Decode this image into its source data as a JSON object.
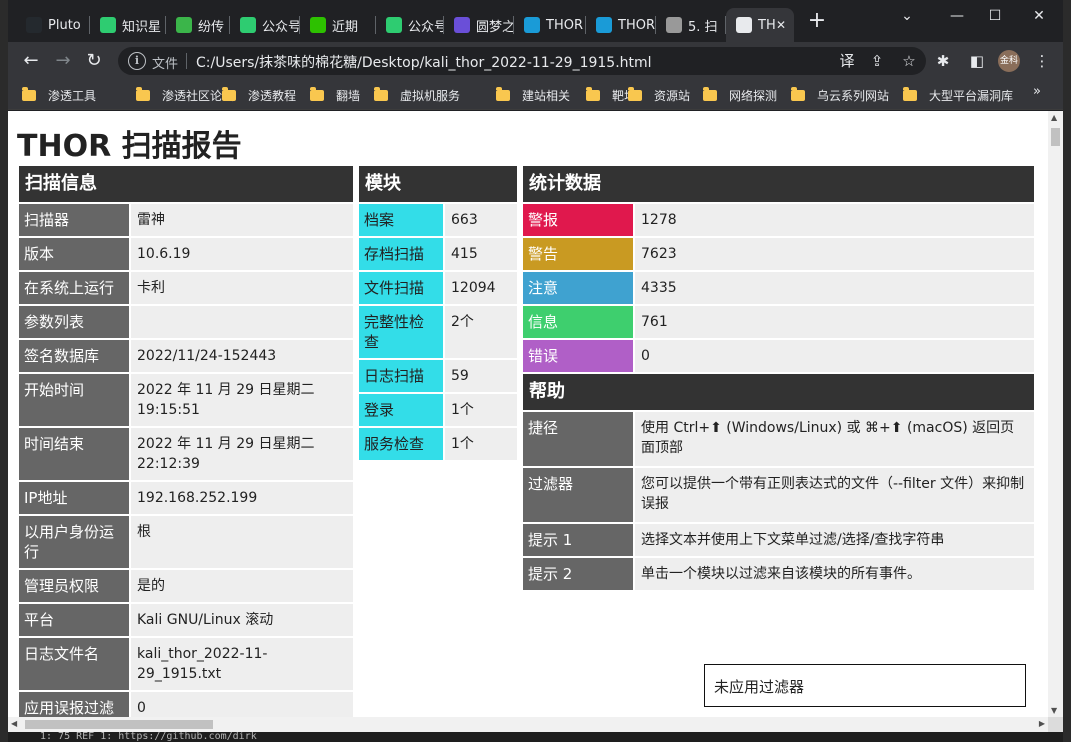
{
  "browser": {
    "tabs": [
      {
        "label": "Pluto",
        "icon": "github-icon",
        "color": "#24292e"
      },
      {
        "label": "知识星",
        "icon": "loading-icon",
        "color": "#2ecc71"
      },
      {
        "label": "纷传",
        "icon": "fenchuan-icon",
        "color": "#3bb54a"
      },
      {
        "label": "公众号",
        "icon": "refresh-icon",
        "color": "#2ecc71"
      },
      {
        "label": "近期",
        "icon": "wechat-icon",
        "color": "#2dc100"
      },
      {
        "label": "公众号",
        "icon": "refresh-icon",
        "color": "#2ecc71"
      },
      {
        "label": "圆梦之",
        "icon": "image-icon",
        "color": "#6a4fd8"
      },
      {
        "label": "THOR",
        "icon": "nextron-icon",
        "color": "#1a9bd7"
      },
      {
        "label": "THOR",
        "icon": "nextron-icon",
        "color": "#1a9bd7"
      },
      {
        "label": "5. 扫",
        "icon": "book-icon",
        "color": "#999999"
      },
      {
        "label": "TH",
        "icon": "globe-icon",
        "color": "#e8eaed"
      }
    ],
    "address": {
      "scheme_label": "文件",
      "url": "C:/Users/抹茶味的棉花糖/Desktop/kali_thor_2022-11-29_1915.html"
    },
    "profile_initials": "金科",
    "bookmarks": [
      "渗透工具",
      "渗透社区论坛",
      "渗透教程",
      "翻墙",
      "虚拟机服务",
      "建站相关",
      "靶场",
      "资源站",
      "网络探测",
      "乌云系列网站",
      "大型平台漏洞库"
    ],
    "bookmarks_more": "»"
  },
  "report": {
    "title": "THOR 扫描报告",
    "scan_info": {
      "heading": "扫描信息",
      "rows": [
        {
          "k": "扫描器",
          "v": "雷神"
        },
        {
          "k": "版本",
          "v": "10.6.19"
        },
        {
          "k": "在系统上运行",
          "v": "卡利"
        },
        {
          "k": "参数列表",
          "v": ""
        },
        {
          "k": "签名数据库",
          "v": "2022/11/24-152443"
        },
        {
          "k": "开始时间",
          "v": "2022 年 11 月 29 日星期二 19:15:51"
        },
        {
          "k": "时间结束",
          "v": "2022 年 11 月 29 日星期二 22:12:39"
        },
        {
          "k": "IP地址",
          "v": "192.168.252.199"
        },
        {
          "k": "以用户身份运行",
          "v": "根"
        },
        {
          "k": "管理员权限",
          "v": "是的"
        },
        {
          "k": "平台",
          "v": "Kali GNU/Linux 滚动"
        },
        {
          "k": "日志文件名",
          "v": "kali_thor_2022-11-29_1915.txt"
        },
        {
          "k": "应用误报过滤器",
          "v": "0"
        }
      ]
    },
    "modules": {
      "heading": "模块",
      "color": "#33dde8",
      "rows": [
        {
          "k": "档案",
          "v": "663"
        },
        {
          "k": "存档扫描",
          "v": "415"
        },
        {
          "k": "文件扫描",
          "v": "12094"
        },
        {
          "k": "完整性检查",
          "v": "2个"
        },
        {
          "k": "日志扫描",
          "v": "59"
        },
        {
          "k": "登录",
          "v": "1个"
        },
        {
          "k": "服务检查",
          "v": "1个"
        }
      ]
    },
    "stats": {
      "heading": "统计数据",
      "rows": [
        {
          "k": "警报",
          "v": "1278",
          "color": "#e0184d"
        },
        {
          "k": "警告",
          "v": "7623",
          "color": "#c99a22"
        },
        {
          "k": "注意",
          "v": "4335",
          "color": "#3fa2d0"
        },
        {
          "k": "信息",
          "v": "761",
          "color": "#3ecf6e"
        },
        {
          "k": "错误",
          "v": "0",
          "color": "#b05fc7"
        }
      ]
    },
    "help": {
      "heading": "帮助",
      "rows": [
        {
          "k": "捷径",
          "v": "使用 Ctrl+⬆ (Windows/Linux) 或 ⌘+⬆ (macOS) 返回页面顶部"
        },
        {
          "k": "过滤器",
          "v": "您可以提供一个带有正则表达式的文件（--filter 文件）来抑制误报"
        },
        {
          "k": "提示 1",
          "v": "选择文本并使用上下文菜单过滤/选择/查找字符串"
        },
        {
          "k": "提示 2",
          "v": "单击一个模块以过滤来自该模块的所有事件。"
        }
      ]
    },
    "filter_status": "未应用过滤器"
  },
  "background_snippet": "1: 75 REF 1: https://github.com/dirk"
}
